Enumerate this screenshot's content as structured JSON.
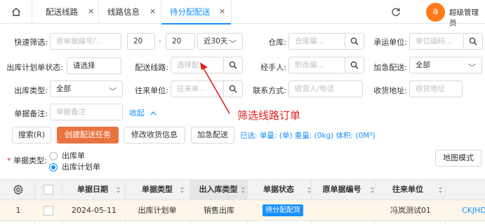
{
  "tabs": [
    {
      "label": "配送线路"
    },
    {
      "label": "线路信息"
    },
    {
      "label": "待分配配送"
    }
  ],
  "header": {
    "avatar_letter": "a",
    "user_name": "超级管理员"
  },
  "filters": {
    "quick_filter": {
      "label": "快速筛选:",
      "placeholder": "原单据编号/..."
    },
    "date_from": "20",
    "date_to": "20",
    "date_range": "近30天",
    "warehouse": {
      "label": "仓库:",
      "placeholder": "仓库编..."
    },
    "carrier": {
      "label": "承运单位:",
      "placeholder": "单位编码..."
    },
    "plan_status": {
      "label": "出库计划单状态:",
      "value": "请选择"
    },
    "route": {
      "label": "配送线路:",
      "placeholder": "选择配..."
    },
    "handler": {
      "label": "经手人:",
      "placeholder": "职员编..."
    },
    "urgent": {
      "label": "加急配送:",
      "value": "全部"
    },
    "out_type": {
      "label": "出库类型:",
      "value": "全部"
    },
    "partner": {
      "label": "往来单位:",
      "placeholder": "往来单..."
    },
    "contact": {
      "label": "联系方式:",
      "placeholder": "收货人/电话"
    },
    "address": {
      "label": "收货地址:",
      "placeholder": "收货地址"
    },
    "remark": {
      "label": "单据备注:",
      "placeholder": "单据备注"
    },
    "collapse": "收起"
  },
  "annotation": "筛选线路订单",
  "toolbar": {
    "search": "搜索(R)",
    "create": "创建配送任务",
    "edit_receipt": "修改收货信息",
    "urgent": "加急配送",
    "selected": "已选: 单量: (单) 重量: (0kg) 体积: (0M³)"
  },
  "doc_type": {
    "label": "单据类型:",
    "options": [
      "出库单",
      "出库计划单"
    ],
    "selected": "出库计划单"
  },
  "map_mode": "地图模式",
  "table": {
    "headers": [
      "单据日期",
      "单据类型",
      "出入库类型",
      "单据状态",
      "原单据编号",
      "往来单位"
    ],
    "rows": [
      {
        "index": "1",
        "date": "2024-05-11",
        "type": "出库计划单",
        "io_type": "销售出库",
        "status": "待分配配货",
        "orig_no": "",
        "partner": "冯岚测试01",
        "code": "CKJHD"
      }
    ]
  },
  "colors": {
    "accent": "#1890ff",
    "primary_button": "#e9733f",
    "annotation": "#e02020",
    "status_badge": "#1890ff"
  }
}
